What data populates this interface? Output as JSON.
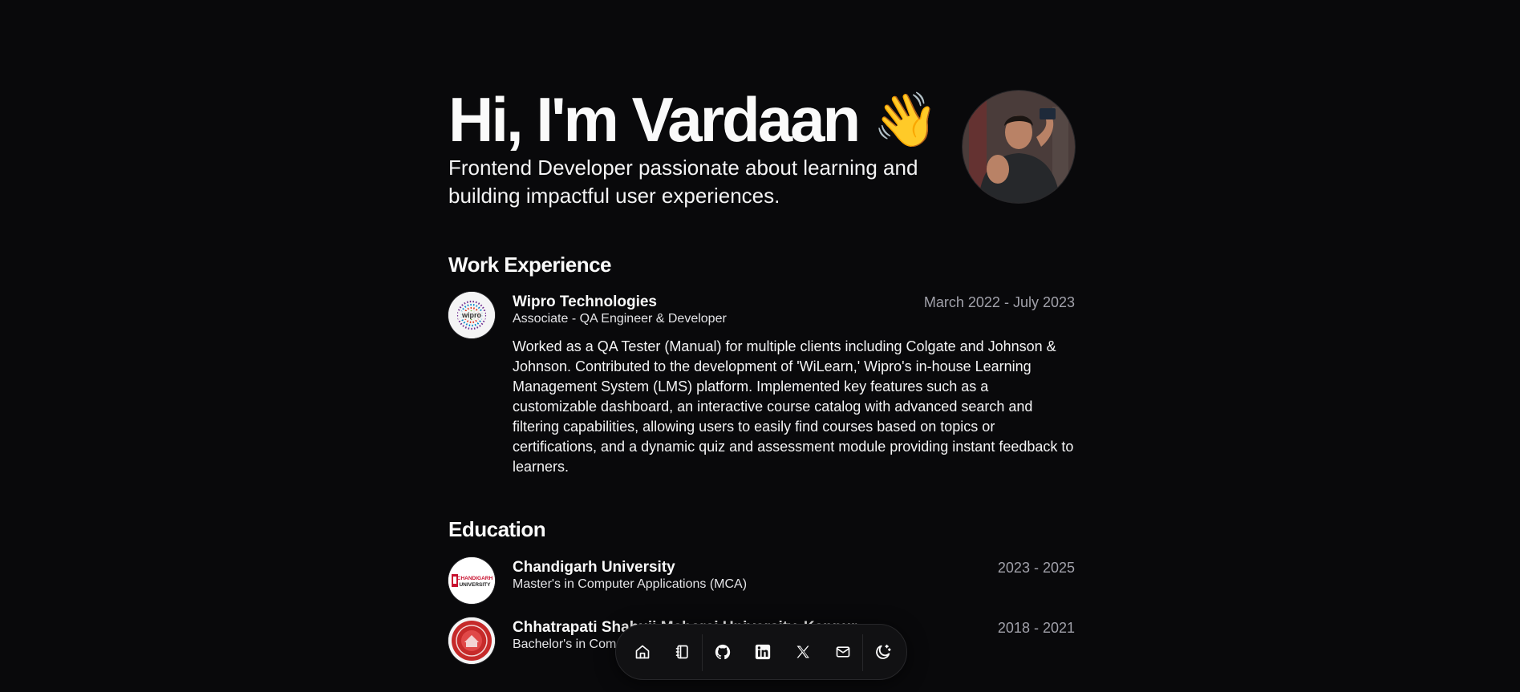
{
  "hero": {
    "title": "Hi, I'm Vardaan",
    "emoji": "👋",
    "subtitle": "Frontend Developer passionate about learning and building impactful user experiences.",
    "avatar_icon": "profile-photo"
  },
  "work": {
    "heading": "Work Experience",
    "items": [
      {
        "company": "Wipro Technologies",
        "role": "Associate - QA Engineer & Developer",
        "dates": "March 2022 - July 2023",
        "logo_text": "wipro",
        "description": "Worked as a QA Tester (Manual) for multiple clients including Colgate and Johnson & Johnson. Contributed to the development of 'WiLearn,' Wipro's in-house Learning Management System (LMS) platform. Implemented key features such as a customizable dashboard, an interactive course catalog with advanced search and filtering capabilities, allowing users to easily find courses based on topics or certifications, and a dynamic quiz and assessment module providing instant feedback to learners."
      }
    ]
  },
  "education": {
    "heading": "Education",
    "items": [
      {
        "school": "Chandigarh University",
        "degree": "Master's in Computer Applications (MCA)",
        "dates": "2023 - 2025",
        "logo_text_1": "CHANDIGARH",
        "logo_text_2": "UNIVERSITY"
      },
      {
        "school": "Chhatrapati Shahuji Maharaj University, Kanpur",
        "degree": "Bachelor's in Computer Applications (BCA)",
        "dates": "2018 - 2021"
      }
    ]
  },
  "dock": {
    "items": [
      "home-icon",
      "notebook-icon",
      "github-icon",
      "linkedin-icon",
      "x-icon",
      "mail-icon",
      "theme-toggle-icon"
    ]
  },
  "colors": {
    "background": "#09090b",
    "text": "#fafafa",
    "muted": "#a1a1aa",
    "border": "#27272a"
  }
}
